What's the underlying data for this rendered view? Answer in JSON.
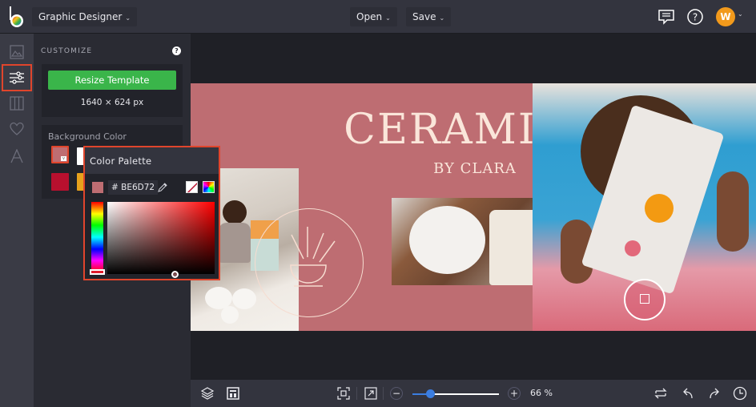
{
  "topbar": {
    "logo_icon": "befunky-logo-icon",
    "title": "Graphic Designer",
    "open_label": "Open",
    "save_label": "Save",
    "chevron": "⌄",
    "comment_icon": "comment-icon",
    "help_icon": "help-icon",
    "avatar_initial": "W"
  },
  "rail": {
    "items": [
      {
        "name": "image-manager",
        "icon": "image-icon",
        "active": false
      },
      {
        "name": "customize",
        "icon": "sliders-icon",
        "active": true
      },
      {
        "name": "layouts",
        "icon": "columns-icon",
        "active": false
      },
      {
        "name": "graphics",
        "icon": "heart-icon",
        "active": false
      },
      {
        "name": "text",
        "icon": "text-icon",
        "active": false
      }
    ]
  },
  "panel": {
    "title": "CUSTOMIZE",
    "help": "?",
    "resize_label": "Resize Template",
    "dimensions": "1640 × 624 px",
    "background_label": "Background Color",
    "swatches": [
      {
        "color": "#be6d72",
        "selected": true
      },
      {
        "color": "#ffffff",
        "selected": false
      },
      {
        "color": "#b8102e",
        "selected": false
      },
      {
        "color": "#e8a21c",
        "selected": false
      }
    ]
  },
  "palette": {
    "title": "Color Palette",
    "current_color": "#be6d72",
    "hex_value": "# BE6D72",
    "eyedropper_icon": "eyedropper-icon",
    "no_color_icon": "no-color-icon",
    "spectrum_icon": "spectrum-icon"
  },
  "design": {
    "title": "CERAMICS",
    "subtitle": "BY CLARA",
    "background_color": "#be6d72",
    "text_color": "#fae6da"
  },
  "bottombar": {
    "layers_icon": "layers-icon",
    "layout_icon": "layout-icon",
    "fit_icon": "fit-to-screen-icon",
    "expand_icon": "expand-icon",
    "zoom_out": "−",
    "zoom_in": "+",
    "zoom_value": 0.2,
    "zoom_label": "66 %",
    "swap_icon": "swap-icon",
    "undo_icon": "undo-icon",
    "redo_icon": "redo-icon",
    "history_icon": "history-icon"
  }
}
